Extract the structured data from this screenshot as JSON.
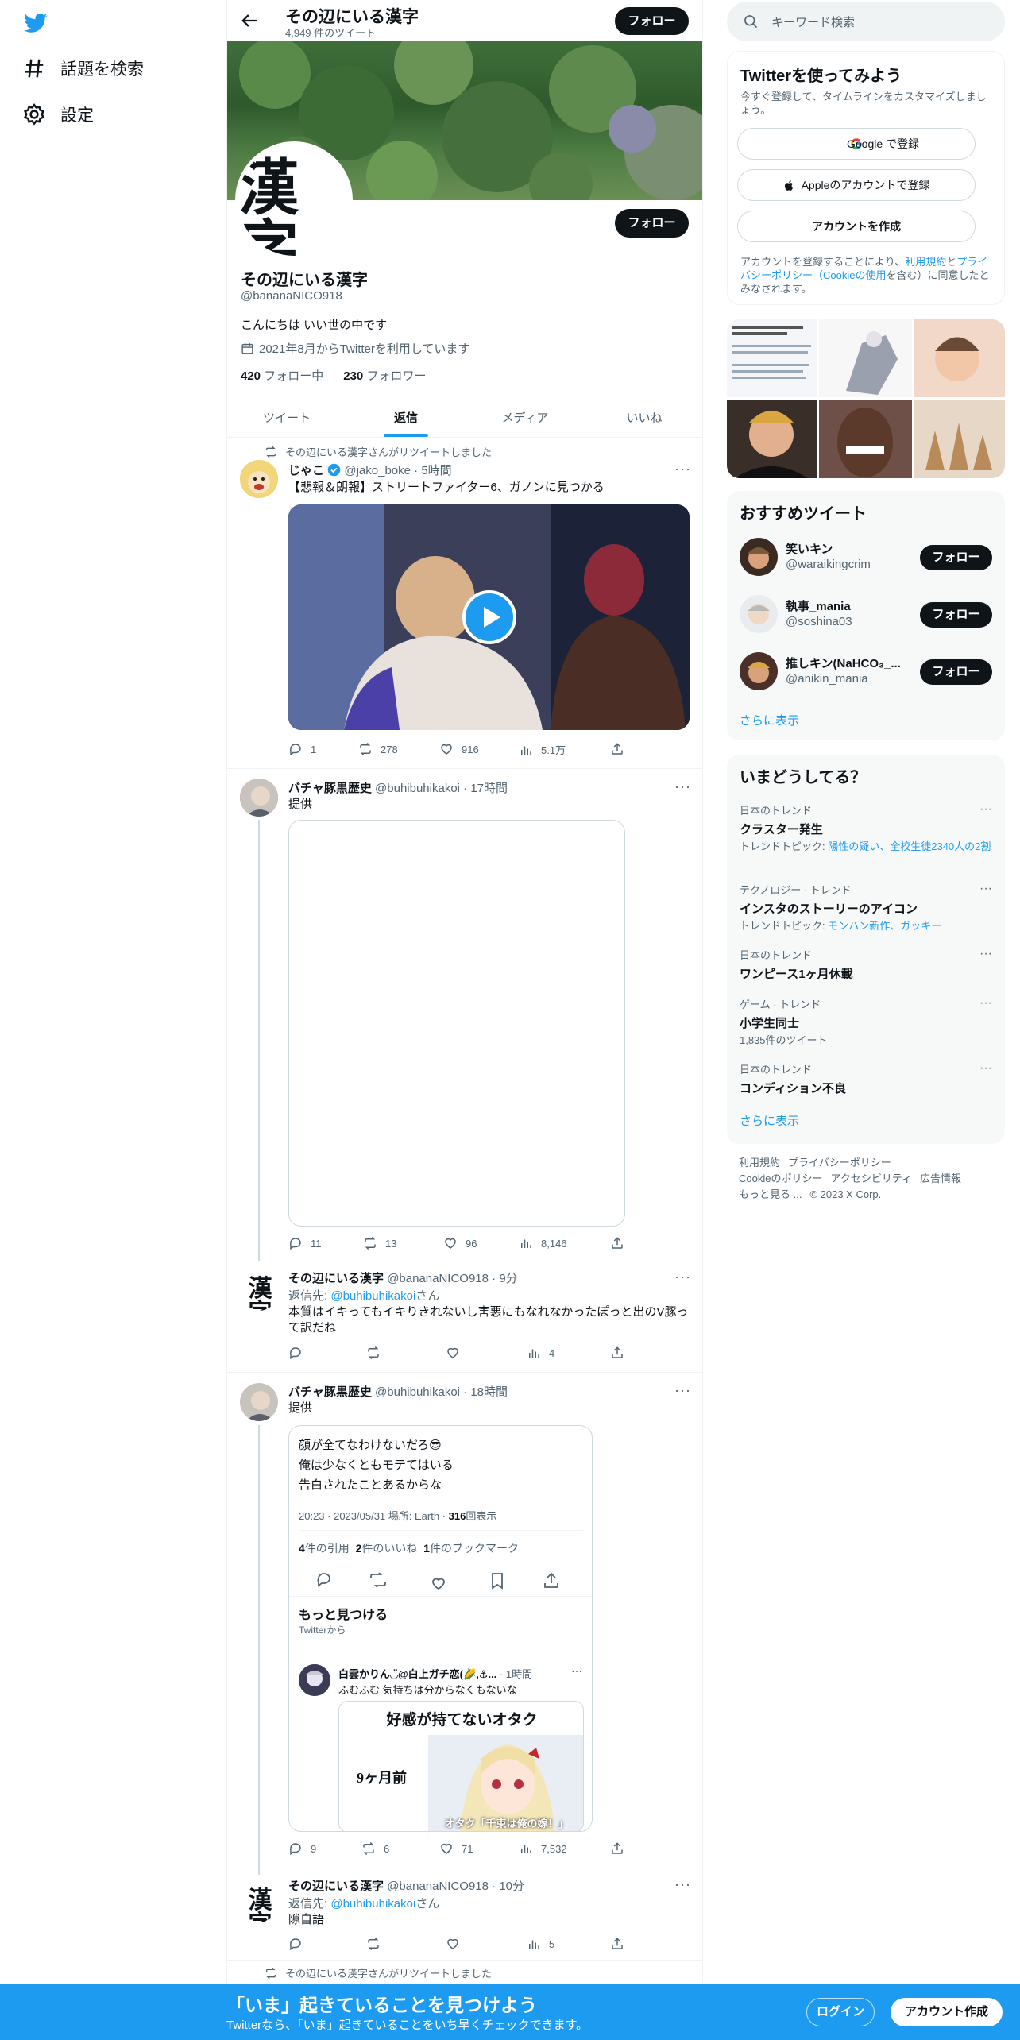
{
  "leftnav": {
    "explore": "話題を検索",
    "settings": "設定"
  },
  "profile": {
    "title": "その辺にいる漢字",
    "tweet_count": "4,949 件のツイート",
    "follow": "フォロー",
    "avatar_text": "漢字",
    "name": "その辺にいる漢字",
    "handle": "@bananaNICO918",
    "bio": "こんにちは いい世の中です",
    "joined": "2021年8月からTwitterを利用しています",
    "following_count": "420",
    "following_label": "フォロー中",
    "followers_count": "230",
    "followers_label": "フォロワー",
    "tabs": [
      "ツイート",
      "返信",
      "メディア",
      "いいね"
    ]
  },
  "tweets": [
    {
      "retweet": "その辺にいる漢字さんがリツイートしました",
      "name": "じゃこ",
      "handle": "@jako_boke",
      "time": "5時間",
      "text": "【悲報＆朗報】ストリートファイター6、ガノンに見つかる",
      "actions": [
        "1",
        "278",
        "916",
        "5.1万"
      ]
    },
    {
      "name": "バチャ豚黒歴史",
      "handle": "@buhibuhikakoi",
      "time": "17時間",
      "text": "提供",
      "actions": [
        "11",
        "13",
        "96",
        "8,146"
      ]
    },
    {
      "name": "その辺にいる漢字",
      "handle": "@bananaNICO918",
      "time": "9分",
      "reply_prefix": "返信先: ",
      "reply_to": "@buhibuhikakoi",
      "reply_suffix": "さん",
      "text": "本質はイキってもイキりきれないし害悪にもなれなかったぽっと出のV豚って訳だね",
      "actions": [
        "",
        "",
        "",
        "4"
      ]
    },
    {
      "name": "バチャ豚黒歴史",
      "handle": "@buhibuhikakoi",
      "time": "18時間",
      "text": "提供",
      "actions": [
        "9",
        "6",
        "71",
        "7,532"
      ],
      "embed": {
        "lines": [
          "顔が全てなわけないだろ😎",
          "俺は少なくともモテてはいる",
          "告白されたことあるからな"
        ],
        "meta_time": "20:23 · 2023/05/31 場所: Earth · ",
        "views": "316",
        "views_label": "回表示",
        "quotes": "4",
        "quotes_label": "件の引用",
        "likes": "2",
        "likes_label": "件のいいね",
        "bookmarks": "1",
        "bookmarks_label": "件のブックマーク",
        "discover": "もっと見つける",
        "discover_sub": "Twitterから",
        "inner_name": "白雲かりん◡̈@白上ガチ恋(🌽,⚓...",
        "inner_time": "1時間",
        "inner_text": "ふむふむ 気持ちは分からなくもないな",
        "manga_title": "好感が持てないオタク",
        "manga_left": "9ヶ月前",
        "manga_caption": "オタク「千束は俺の嫁！」"
      }
    },
    {
      "name": "その辺にいる漢字",
      "handle": "@bananaNICO918",
      "time": "10分",
      "reply_prefix": "返信先: ",
      "reply_to": "@buhibuhikakoi",
      "reply_suffix": "さん",
      "text": "隙自語",
      "actions": [
        "",
        "",
        "",
        "5"
      ]
    },
    {
      "retweet": "その辺にいる漢字さんがリツイートしました"
    }
  ],
  "sidebar": {
    "search_placeholder": "キーワード検索",
    "signup": {
      "title": "Twitterを使ってみよう",
      "desc": "今すぐ登録して、タイムラインをカスタマイズしましょう。",
      "google": "Google で登録",
      "apple": "Appleのアカウントで登録",
      "create": "アカウントを作成",
      "legal_a": "アカウントを登録することにより、",
      "legal_tos": "利用規約",
      "legal_b": "と",
      "legal_pp": "プライバシーポリシー（Cookieの使用",
      "legal_c": "を含む）に同意したとみなされます。"
    },
    "recommended": {
      "title": "おすすめツイート",
      "follow": "フォロー",
      "show_more": "さらに表示",
      "users": [
        {
          "name": "笑いキン",
          "handle": "@waraikingcrim"
        },
        {
          "name": "執事_mania",
          "handle": "@soshina03"
        },
        {
          "name": "推しキン(NaHCO₃_...",
          "handle": "@anikin_mania"
        }
      ]
    },
    "trends": {
      "title": "いまどうしてる？",
      "show_more": "さらに表示",
      "items": [
        {
          "cat": "日本のトレンド",
          "name": "クラスター発生",
          "sub_prefix": "トレンドトピック: ",
          "sub": "陽性の疑い、全校生徒2340人の2割"
        },
        {
          "cat": "テクノロジー · トレンド",
          "name": "インスタのストーリーのアイコン",
          "sub_prefix": "トレンドトピック: ",
          "sub": "モンハン新作、ガッキー"
        },
        {
          "cat": "日本のトレンド",
          "name": "ワンピース1ヶ月休載",
          "sub_prefix": "",
          "sub": ""
        },
        {
          "cat": "ゲーム · トレンド",
          "name": "小学生同士",
          "sub_prefix": "1,835件のツイート",
          "sub": ""
        },
        {
          "cat": "日本のトレンド",
          "name": "コンディション不良",
          "sub_prefix": "",
          "sub": ""
        }
      ]
    },
    "footer": [
      "利用規約",
      "プライバシーポリシー",
      "Cookieのポリシー",
      "アクセシビリティ",
      "広告情報",
      "もっと見る ...",
      "© 2023 X Corp."
    ]
  },
  "bottom": {
    "title": "「いま」起きていることを見つけよう",
    "sub": "Twitterなら、「いま」起きていることをいち早くチェックできます。",
    "login": "ログイン",
    "signup": "アカウント作成"
  },
  "colors": {
    "accent": "#1d9bf0",
    "text": "#0f1419",
    "muted": "#536471"
  }
}
